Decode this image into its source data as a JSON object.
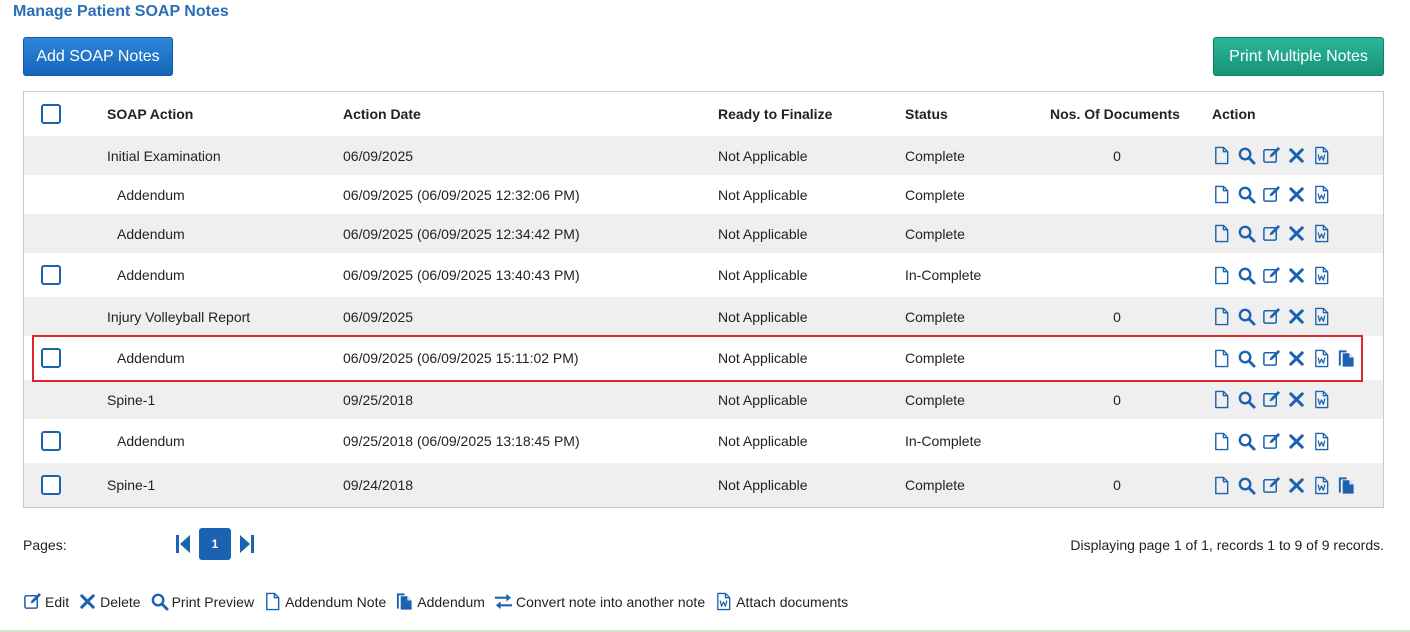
{
  "page_title": "Manage Patient SOAP Notes",
  "buttons": {
    "add_soap": "Add SOAP Notes",
    "print_multiple": "Print Multiple Notes"
  },
  "table": {
    "headers": {
      "soap_action": "SOAP Action",
      "action_date": "Action Date",
      "ready": "Ready to Finalize",
      "status": "Status",
      "docs": "Nos. Of Documents",
      "action": "Action"
    },
    "rows": [
      {
        "action": "Initial Examination",
        "date": "06/09/2025",
        "ready": "Not Applicable",
        "status": "Complete",
        "docs": "0"
      },
      {
        "action": "Addendum",
        "date": "06/09/2025 (06/09/2025 12:32:06 PM)",
        "ready": "Not Applicable",
        "status": "Complete",
        "docs": ""
      },
      {
        "action": "Addendum",
        "date": "06/09/2025 (06/09/2025 12:34:42 PM)",
        "ready": "Not Applicable",
        "status": "Complete",
        "docs": ""
      },
      {
        "action": "Addendum",
        "date": "06/09/2025 (06/09/2025 13:40:43 PM)",
        "ready": "Not Applicable",
        "status": "In-Complete",
        "docs": ""
      },
      {
        "action": "Injury Volleyball Report",
        "date": "06/09/2025",
        "ready": "Not Applicable",
        "status": "Complete",
        "docs": "0"
      },
      {
        "action": "Addendum",
        "date": "06/09/2025 (06/09/2025 15:11:02 PM)",
        "ready": "Not Applicable",
        "status": "Complete",
        "docs": ""
      },
      {
        "action": "Spine-1",
        "date": "09/25/2018",
        "ready": "Not Applicable",
        "status": "Complete",
        "docs": "0"
      },
      {
        "action": "Addendum",
        "date": "09/25/2018 (06/09/2025 13:18:45 PM)",
        "ready": "Not Applicable",
        "status": "In-Complete",
        "docs": ""
      },
      {
        "action": "Spine-1",
        "date": "09/24/2018",
        "ready": "Not Applicable",
        "status": "Complete",
        "docs": "0"
      }
    ]
  },
  "pager": {
    "label": "Pages:",
    "current": "1",
    "records": "Displaying page 1 of 1, records 1 to 9 of 9 records."
  },
  "legend": {
    "edit": "Edit",
    "delete": "Delete",
    "print_preview": "Print Preview",
    "addendum_note": "Addendum Note",
    "addendum": "Addendum",
    "convert": "Convert note into another note",
    "attach": "Attach documents"
  },
  "colors": {
    "accent": "#1b63b0",
    "title": "#2a6fb5",
    "print_button": "#1fa387",
    "highlight": "#e0262b"
  }
}
